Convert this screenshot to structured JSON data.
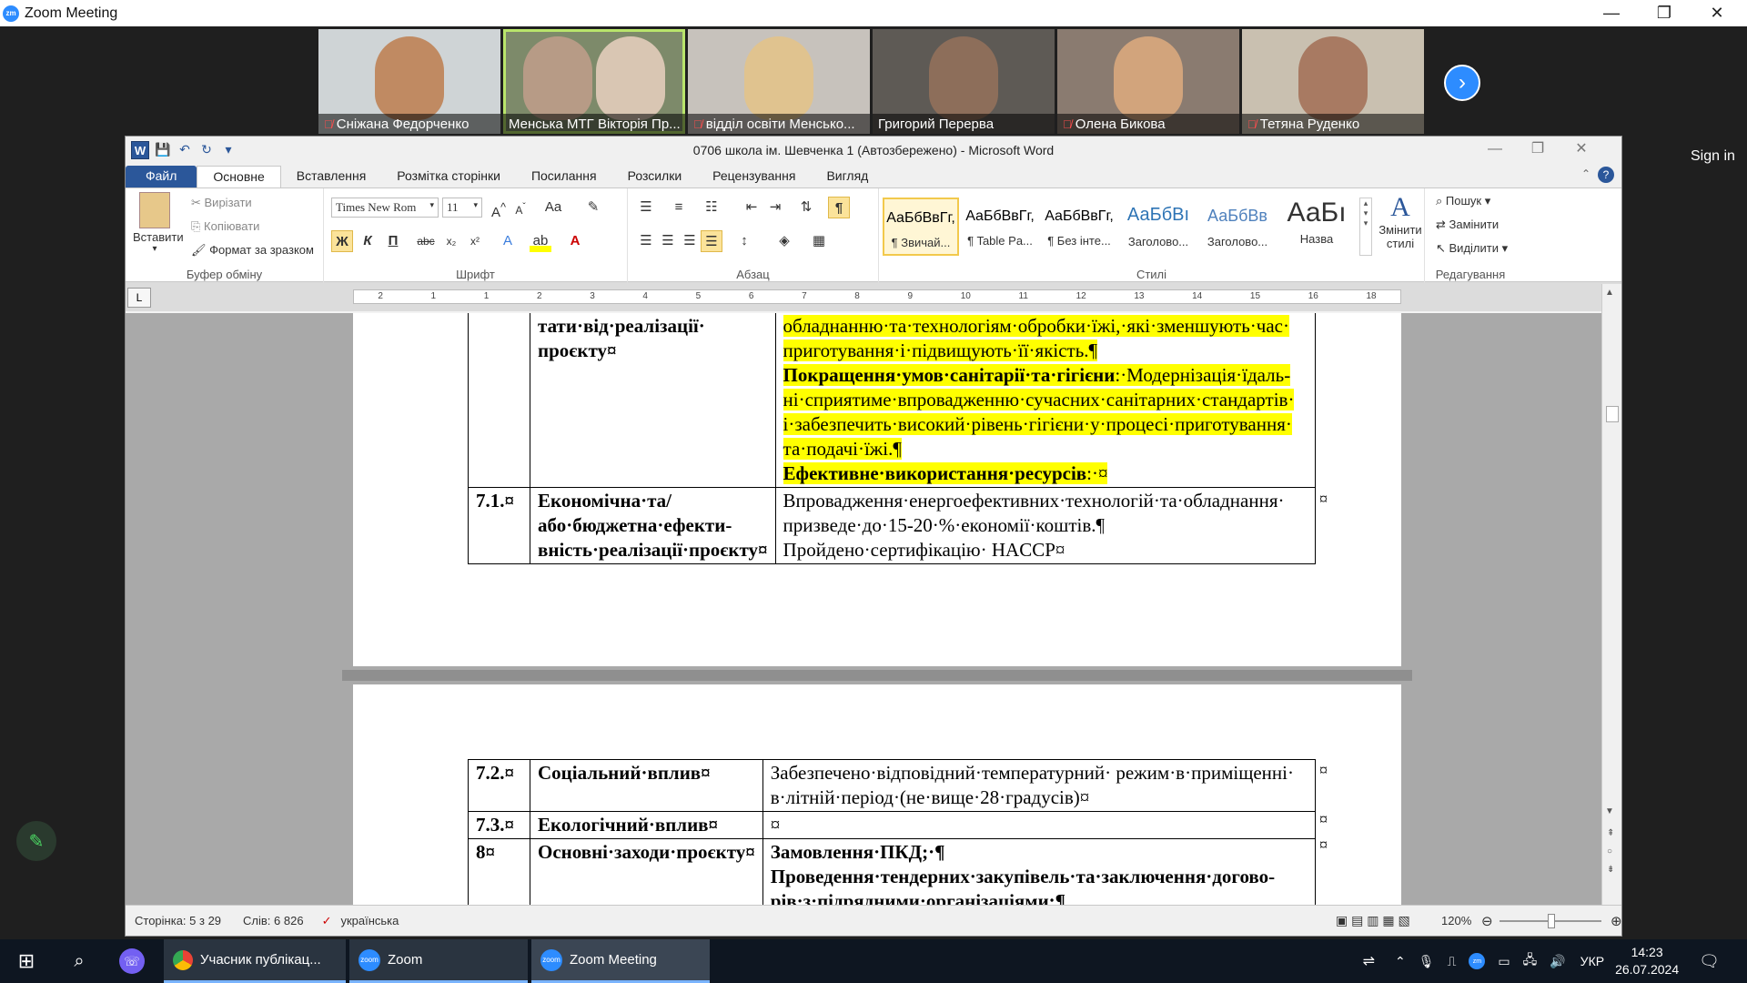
{
  "zoom": {
    "title": "Zoom Meeting",
    "sign_in": "Sign in",
    "participants": [
      {
        "name": "Сніжана Федорченко",
        "muted": true
      },
      {
        "name": "Менська МТГ Вікторія Пр...",
        "muted": false,
        "active": true
      },
      {
        "name": "відділ освіти Менсько...",
        "muted": true
      },
      {
        "name": "Григорий Перерва",
        "muted": false
      },
      {
        "name": "Олена Бикова",
        "muted": true
      },
      {
        "name": "Тетяна Руденко",
        "muted": true
      }
    ]
  },
  "word": {
    "title": "0706 школа ім. Шевченка 1 (Автозбережено) - Microsoft Word",
    "tabs": [
      "Файл",
      "Основне",
      "Вставлення",
      "Розмітка сторінки",
      "Посилання",
      "Розсилки",
      "Рецензування",
      "Вигляд"
    ],
    "clipboard": {
      "paste": "Вставити",
      "cut": "Вирізати",
      "copy": "Копіювати",
      "format_painter": "Формат за зразком",
      "label": "Буфер обміну"
    },
    "font": {
      "name": "Times New Rom",
      "size": "11",
      "label": "Шрифт",
      "bold": "Ж",
      "italic": "К",
      "underline": "П"
    },
    "paragraph_label": "Абзац",
    "styles": {
      "label": "Стилі",
      "items": [
        {
          "sample": "АаБбВвГг,",
          "name": "¶ Звичай..."
        },
        {
          "sample": "АаБбВвГг,",
          "name": "¶ Table Pa..."
        },
        {
          "sample": "АаБбВвГг,",
          "name": "¶ Без інте..."
        },
        {
          "sample": "АаБбВı",
          "name": "Заголово..."
        },
        {
          "sample": "АаБбВв",
          "name": "Заголово..."
        },
        {
          "sample": "АаБı",
          "name": "Назва"
        }
      ],
      "change": "Змінити стилі"
    },
    "editing": {
      "label": "Редагування",
      "find": "Пошук",
      "replace": "Замінити",
      "select": "Виділити"
    },
    "ruler_marks": [
      "2",
      "1",
      "1",
      "2",
      "3",
      "4",
      "5",
      "6",
      "7",
      "8",
      "9",
      "10",
      "11",
      "12",
      "13",
      "14",
      "15",
      "16",
      "18"
    ],
    "doc": {
      "row0_col2": "тати·від·реалізації·",
      "row0_col2b": "проєкту¤",
      "row0_line1": "обладнанню·та·технологіям·обробки·їжі,·які·зменшують·час·",
      "row0_line2": "приготування·і·підвищують·її·якість.¶",
      "row0_line3_bold": "Покращення·умов·санітарії·та·гігієни",
      "row0_line3_rest": ":·Модернізація·їдаль-",
      "row0_line4": "ні·сприятиме·впровадженню·сучасних·санітарних·стандартів·",
      "row0_line5": "і·забезпечить·високий·рівень·гігієни·у·процесі·приготування·",
      "row0_line6": "та·подачі·їжі.¶",
      "row0_line7_bold": "Ефективне·використання·ресурсів",
      "row0_line7_rest": ":·¤",
      "r71_num": "7.1.¤",
      "r71_title": "Економічна·та/або·бюджетна·ефекти-вність·реалізації·проєкту¤",
      "r71_line1": "Впровадження·енергоефективних·технологій·та·обладнання·",
      "r71_line2": "призведе·до·15-20·%·економії·коштів.¶",
      "r71_line3": "Пройдено·сертифікацію· HACCP¤",
      "r72_num": "7.2.¤",
      "r72_title": "Соціальний·вплив¤",
      "r72_line1": "Забезпечено·відповідний·температурний· режим·в·приміщенні·",
      "r72_line2": "в·літній·період·(не·вище·28·градусів)¤",
      "r73_num": "7.3.¤",
      "r73_title": "Екологічний·вплив¤",
      "r73_text": "¤",
      "r8_num": "8¤",
      "r8_title": "Основні·заходи·проєкту¤",
      "r8_line1": "Замовлення·ПКД;·¶",
      "r8_line2": "Проведення·тендерних·закупівель·та·заключення·догово-",
      "r8_line3": "рів·з·підрядними·організаціями;¶",
      "end_mark": "¤"
    },
    "status": {
      "page": "Сторінка: 5 з 29",
      "words": "Слів: 6 826",
      "language": "українська",
      "zoom": "120%"
    }
  },
  "taskbar": {
    "items": [
      "Учасник публікац...",
      "Zoom",
      "Zoom Meeting"
    ],
    "lang": "УКР",
    "time": "14:23",
    "date": "26.07.2024"
  },
  "colors": {
    "word_blue": "#2b579a",
    "zoom_blue": "#2d8cff",
    "highlight": "#ffff00"
  }
}
